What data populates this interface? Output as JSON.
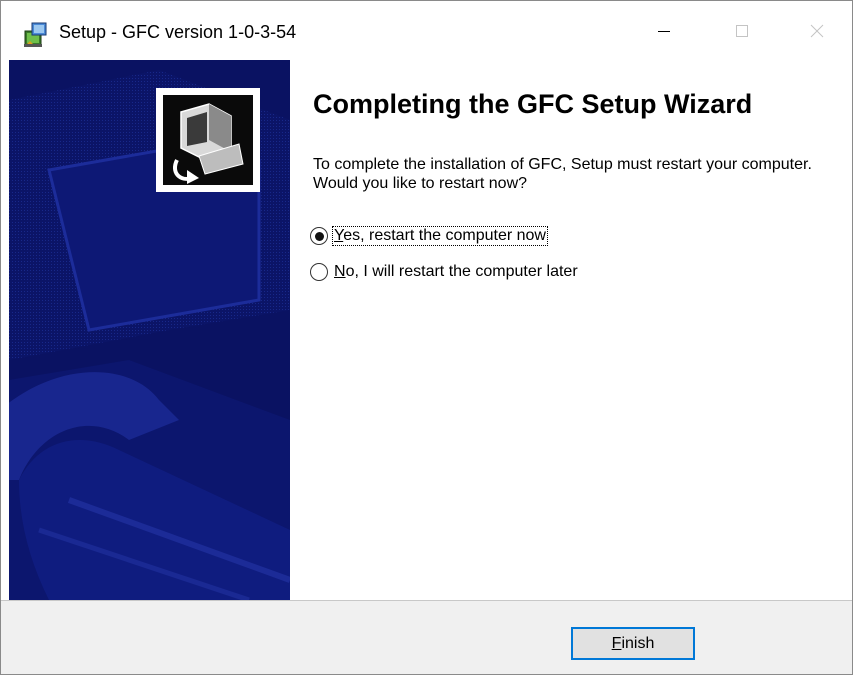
{
  "window": {
    "title": "Setup - GFC version 1-0-3-54",
    "icon": "setup-installer-icon",
    "controls": {
      "minimize": "minimize-icon",
      "maximize": "maximize-icon",
      "close": "close-icon"
    }
  },
  "banner": {
    "icon": "installer-computer-icon",
    "background_color": "#0b1468"
  },
  "main": {
    "heading": "Completing the GFC Setup Wizard",
    "description": "To complete the installation of GFC, Setup must restart your computer. Would you like to restart now?",
    "options": [
      {
        "mnemonic": "Y",
        "label_rest": "es, restart the computer now",
        "selected": true
      },
      {
        "mnemonic": "N",
        "label_rest": "o, I will restart the computer later",
        "selected": false
      }
    ]
  },
  "footer": {
    "finish_mnemonic": "F",
    "finish_rest": "inish",
    "accent_color": "#0078d7"
  }
}
